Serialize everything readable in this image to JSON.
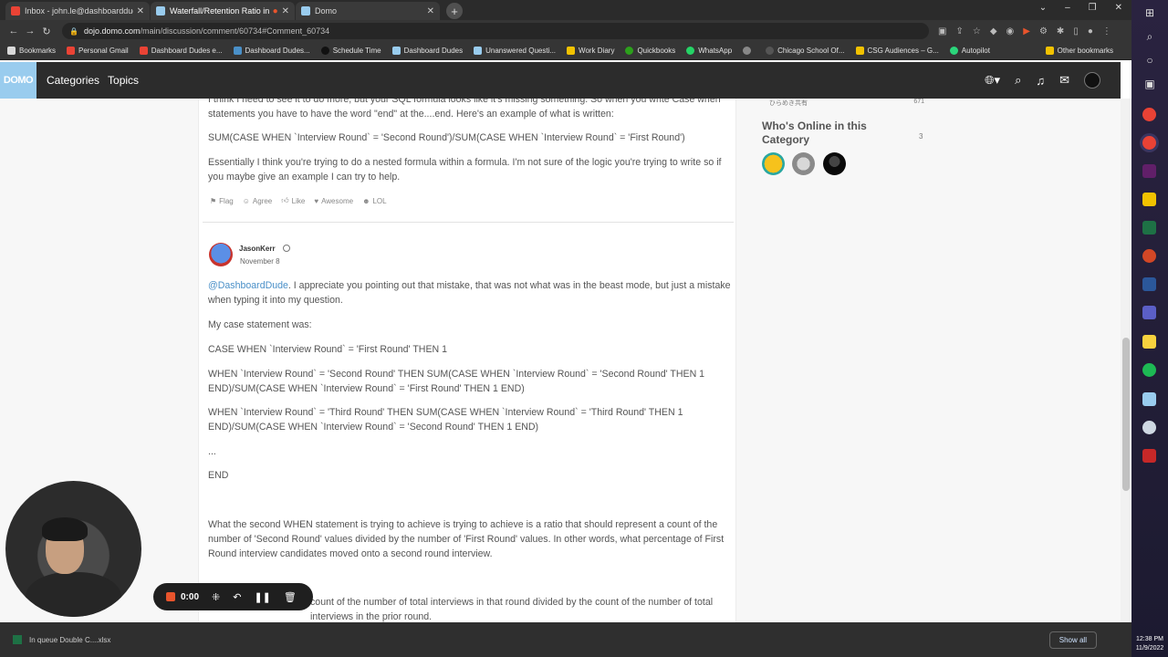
{
  "browser": {
    "tabs": [
      {
        "title": "Inbox - john.le@dashboarddude",
        "fav_color": "#ea4335",
        "active": false
      },
      {
        "title": "Waterfall/Retention Ratio in",
        "fav_color": "#99ccee",
        "active": true
      },
      {
        "title": "Domo",
        "fav_color": "#99ccee",
        "active": false
      }
    ],
    "new_tab_label": "+",
    "address": {
      "host": "dojo.domo.com",
      "path": "/main/discussion/comment/60734#Comment_60734"
    },
    "bookmarks": [
      {
        "label": "Bookmarks",
        "color": "#d9d9d9"
      },
      {
        "label": "Personal Gmail",
        "color": "#ea4335"
      },
      {
        "label": "Dashboard Dudes e...",
        "color": "#ea4335"
      },
      {
        "label": "Dashboard Dudes...",
        "color": "#4a90c8"
      },
      {
        "label": "Schedule Time",
        "color": "#111111"
      },
      {
        "label": "Dashboard Dudes",
        "color": "#99ccee"
      },
      {
        "label": "Unanswered Questi...",
        "color": "#99ccee"
      },
      {
        "label": "Work Diary",
        "color": "#f2c200"
      },
      {
        "label": "Quickbooks",
        "color": "#2ca01c"
      },
      {
        "label": "WhatsApp",
        "color": "#25d366"
      },
      {
        "label": "",
        "color": "#888888"
      },
      {
        "label": "Chicago School Of...",
        "color": "#555555"
      },
      {
        "label": "CSG Audiences – G...",
        "color": "#f2c200"
      },
      {
        "label": "Autopilot",
        "color": "#2bd67b"
      }
    ],
    "other_bookmarks": "Other bookmarks"
  },
  "domo_header": {
    "logo": "DOMO",
    "nav": [
      "Categories",
      "Topics"
    ]
  },
  "post1": {
    "lines": [
      "I think I need to see it to do more, but your SQL formula looks like it's missing something. So when you write Case when statements you have to have the word \"end\" at the....end. Here's an example of what is written:",
      "SUM(CASE WHEN `Interview Round` = 'Second Round')/SUM(CASE WHEN `Interview Round` = 'First Round')",
      "Essentially I think you're trying to do a nested formula within a formula. I'm not sure of the logic you're trying to write so if you maybe give an example I can try to help."
    ],
    "actions": [
      "Flag",
      "Agree",
      "Like",
      "Awesome",
      "LOL"
    ]
  },
  "post2": {
    "author": "JasonKerr",
    "date": "November 8",
    "mention": "@DashboardDude",
    "intro": ". I appreciate you pointing out that mistake, that was not what was in the beast mode, but just a mistake when typing it into my question.",
    "paragraphs": [
      "My case statement was:",
      "CASE WHEN `Interview Round` = 'First Round' THEN 1",
      "WHEN `Interview Round` = 'Second Round' THEN SUM(CASE WHEN `Interview Round` = 'Second Round' THEN 1 END)/SUM(CASE WHEN `Interview Round` = 'First Round' THEN 1 END)",
      "WHEN `Interview Round` = 'Third Round' THEN SUM(CASE WHEN `Interview Round` = 'Third Round' THEN 1 END)/SUM(CASE WHEN `Interview Round` = 'Second Round' THEN 1 END)",
      "...",
      "END",
      "What the second WHEN statement is trying to achieve is trying to achieve is a ratio that should represent a count of the number of 'Second Round' values divided by the number of 'First Round' values. In other words, what percentage of First Round interview candidates moved onto a second round interview.",
      "count of the number of total interviews in that round divided by the count of the number of total interviews in the prior round."
    ]
  },
  "sidebar": {
    "partial_item": {
      "label": "ひらめき共有",
      "count": "671"
    },
    "who_online_title": "Who's Online in this Category",
    "who_online_count": "3"
  },
  "recording": {
    "time": "0:00",
    "accent": "#e8542c"
  },
  "downloads": {
    "file": "In queue Double C....xlsx",
    "show_all": "Show all"
  },
  "taskbar": {
    "time": "12:38 PM",
    "date": "11/9/2022"
  }
}
